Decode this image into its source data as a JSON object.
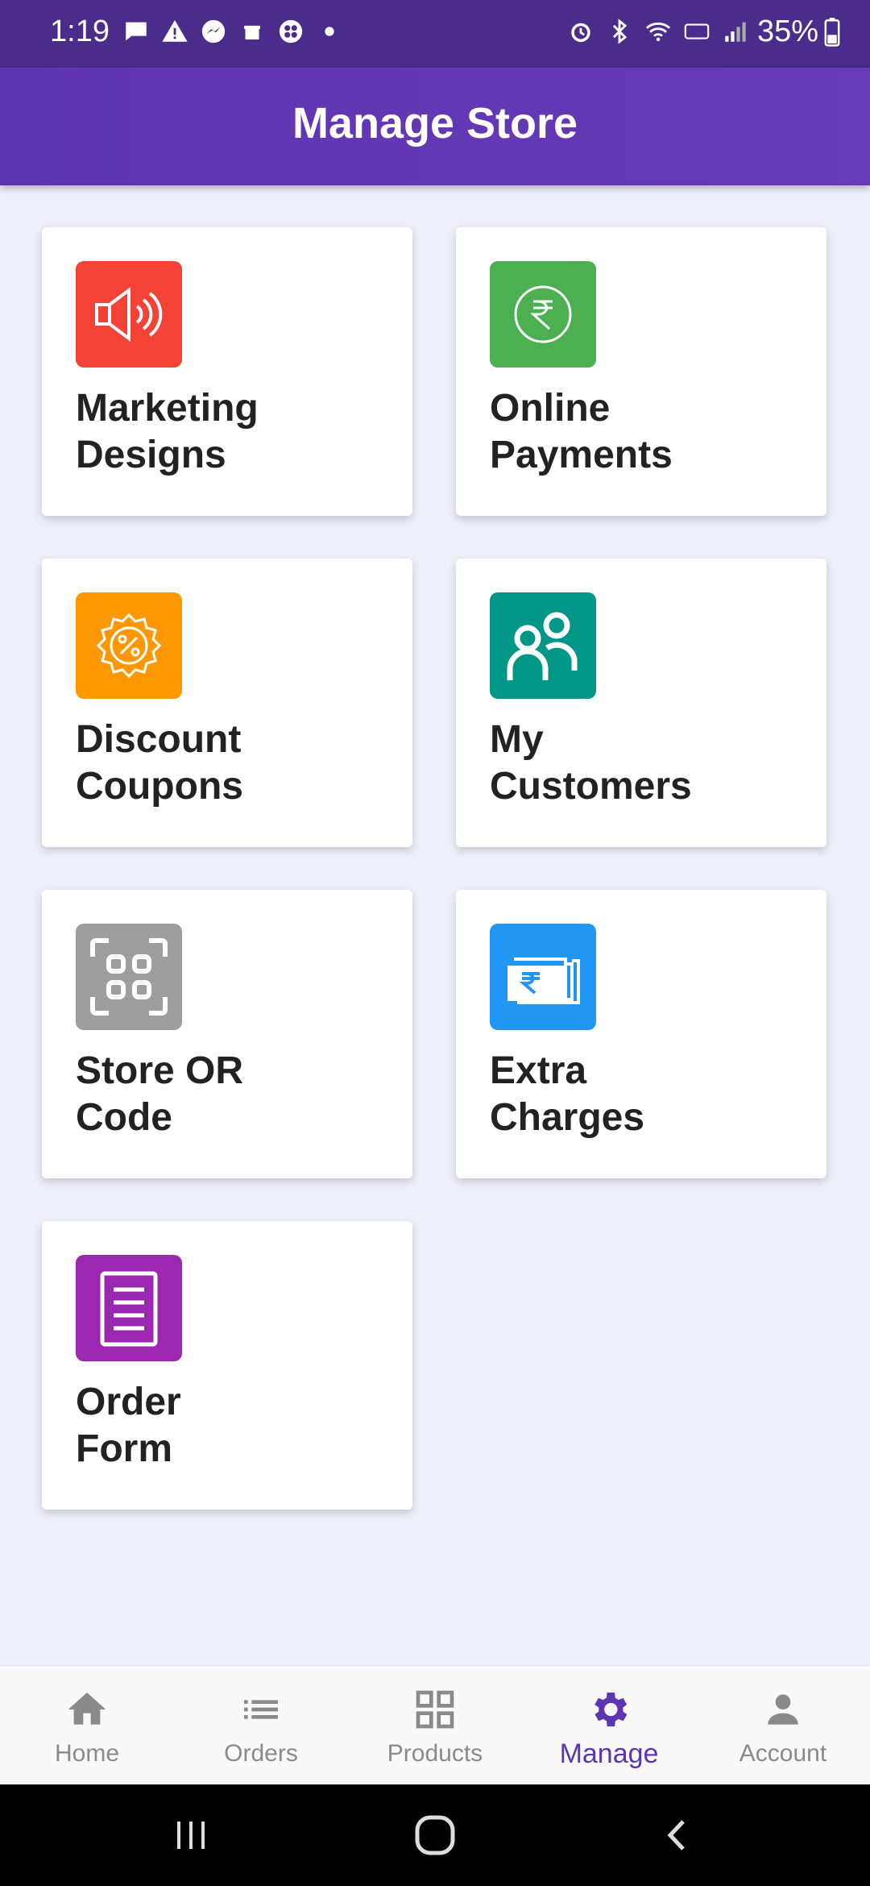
{
  "status_bar": {
    "time": "1:19",
    "battery": "35%"
  },
  "app_bar": {
    "title": "Manage Store"
  },
  "cards": [
    {
      "id": "marketing",
      "label_line1": "Marketing",
      "label_line2": "Designs",
      "icon": "megaphone-icon",
      "color": "#F44336"
    },
    {
      "id": "payments",
      "label_line1": "Online",
      "label_line2": "Payments",
      "icon": "rupee-circle-icon",
      "color": "#4CAF50"
    },
    {
      "id": "coupons",
      "label_line1": "Discount",
      "label_line2": "Coupons",
      "icon": "discount-badge-icon",
      "color": "#FF9800"
    },
    {
      "id": "customers",
      "label_line1": "My",
      "label_line2": "Customers",
      "icon": "customers-icon",
      "color": "#009688"
    },
    {
      "id": "qr",
      "label_line1": "Store OR",
      "label_line2": "Code",
      "icon": "qr-scan-icon",
      "color": "#9E9E9E"
    },
    {
      "id": "charges",
      "label_line1": "Extra",
      "label_line2": "Charges",
      "icon": "rupee-notes-icon",
      "color": "#2196F3"
    },
    {
      "id": "order",
      "label_line1": "Order",
      "label_line2": "Form",
      "icon": "form-document-icon",
      "color": "#9C27B0"
    }
  ],
  "bottom_nav": [
    {
      "label": "Home",
      "icon": "home-icon",
      "active": false
    },
    {
      "label": "Orders",
      "icon": "list-icon",
      "active": false
    },
    {
      "label": "Products",
      "icon": "grid-icon",
      "active": false
    },
    {
      "label": "Manage",
      "icon": "gear-icon",
      "active": true
    },
    {
      "label": "Account",
      "icon": "person-icon",
      "active": false
    }
  ],
  "colors": {
    "primary": "#673AB7",
    "status_bar": "#4A2C8A",
    "background": "#EFEFFA",
    "nav_inactive": "#8A8A8A",
    "nav_active": "#5E35B1"
  }
}
